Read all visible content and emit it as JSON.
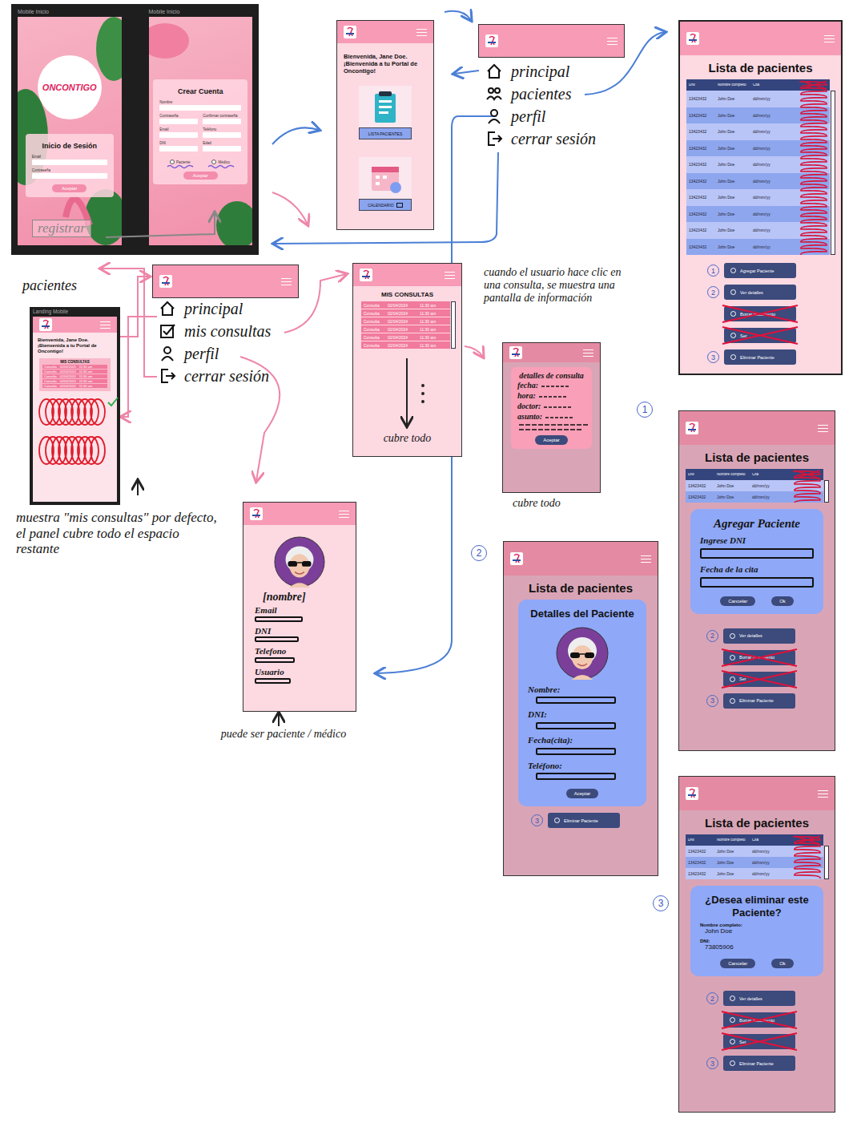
{
  "login": {
    "label": "Mobile Inicio",
    "logo": "ONCONTIGO",
    "title": "Inicio de Sesión",
    "fields": [
      "Email",
      "Contraseña"
    ],
    "button": "Aceptar"
  },
  "register": {
    "label": "Mobile Inicio",
    "title": "Crear Cuenta",
    "fields": [
      [
        "Nombre"
      ],
      [
        "Contraseña",
        "Confirmar contraseña"
      ],
      [
        "Email",
        "Teléfono"
      ],
      [
        "DNI",
        "Edad"
      ]
    ],
    "roles": [
      {
        "label": "Paciente",
        "selected": false
      },
      {
        "label": "Médico",
        "selected": false
      }
    ],
    "button": "Aceptar"
  },
  "landing": {
    "greeting": "Bienvenida, Jane Doe. ¡Bienvenida a tu Portal de Oncontigo!",
    "cards": [
      "LISTA PACIENTES",
      "CALENDARIO"
    ]
  },
  "menu_doctor": {
    "items": [
      "principal",
      "pacientes",
      "perfil",
      "cerrar sesión"
    ]
  },
  "patients": {
    "title": "Lista de pacientes",
    "columns": [
      "DNI",
      "Nombre completo",
      "Cita"
    ],
    "rows": [
      [
        "13423432",
        "John Doe",
        "dd/mm/yy"
      ],
      [
        "13423432",
        "John Doe",
        "dd/mm/yy"
      ],
      [
        "13423432",
        "John Doe",
        "dd/mm/yy"
      ],
      [
        "13423432",
        "John Doe",
        "dd/mm/yy"
      ],
      [
        "13423432",
        "John Doe",
        "dd/mm/yy"
      ],
      [
        "13423432",
        "John Doe",
        "dd/mm/yy"
      ],
      [
        "13423432",
        "John Doe",
        "dd/mm/yy"
      ],
      [
        "13423432",
        "John Doe",
        "dd/mm/yy"
      ],
      [
        "13423432",
        "John Doe",
        "dd/mm/yy"
      ],
      [
        "13423432",
        "John Doe",
        "dd/mm/yy"
      ]
    ],
    "actions": [
      {
        "number": "1",
        "label": "Agregar Paciente",
        "crossed": false
      },
      {
        "number": "2",
        "label": "Ver detalles",
        "crossed": false
      },
      {
        "label": "Borrar documento",
        "crossed": true
      },
      {
        "label": "Ser",
        "crossed": true
      },
      {
        "number": "3",
        "label": "Eliminar Paciente",
        "crossed": false
      }
    ]
  },
  "landing_mobile": {
    "label": "Landing Mobile",
    "greeting": "Bienvenida, Jane Doe. ¡Bienvenida a tu Portal de Oncontigo!",
    "panel_title": "MIS CONSULTAS",
    "rows": [
      [
        "Consulta",
        "02/04/2024",
        "11:30 am"
      ],
      [
        "Consulta",
        "02/04/2024",
        "11:30 am"
      ],
      [
        "Consulta",
        "02/04/2024",
        "11:30 am"
      ],
      [
        "Consulta",
        "02/04/2024",
        "11:30 am"
      ],
      [
        "Consulta",
        "02/04/2024",
        "11:30 am"
      ]
    ]
  },
  "menu_patient": {
    "items": [
      "principal",
      "mis consultas",
      "perfil",
      "cerrar sesión"
    ]
  },
  "consultas": {
    "title": "MIS CONSULTAS",
    "rows": [
      [
        "Consulta",
        "02/04/2024",
        "11:30 am"
      ],
      [
        "Consulta",
        "02/04/2024",
        "11:30 am"
      ],
      [
        "Consulta",
        "02/04/2024",
        "11:30 am"
      ],
      [
        "Consulta",
        "02/04/2024",
        "11:30 am"
      ],
      [
        "Consulta",
        "02/04/2024",
        "11:30 am"
      ],
      [
        "Consulta",
        "02/04/2024",
        "11:30 am"
      ]
    ],
    "note": "cubre todo"
  },
  "consult_detail": {
    "title": "detalles de consulta",
    "fields": [
      "fecha:",
      "hora:",
      "doctor:",
      "asunto:"
    ],
    "button": "Aceptar",
    "note": "cubre todo"
  },
  "profile": {
    "name": "[nombre]",
    "fields": [
      "Email",
      "DNI",
      "Telefono",
      "Usuario"
    ],
    "note": "puede ser paciente / médico"
  },
  "details_screen": {
    "title": "Lista de pacientes",
    "modal_title": "Detalles del Paciente",
    "fields": [
      "Nombre:",
      "DNI:",
      "Fecha(cita):",
      "Teléfono:"
    ],
    "button": "Aceptar",
    "actions": [
      {
        "number": "3",
        "label": "Eliminar Paciente",
        "crossed": false
      }
    ]
  },
  "add_screen": {
    "title": "Lista de pacientes",
    "columns": [
      "DNI",
      "Nombre completo",
      "Cita"
    ],
    "rows": [
      [
        "13423432",
        "John Doe",
        "dd/mm/yy"
      ],
      [
        "13423432",
        "John Doe",
        "dd/mm/yy"
      ]
    ],
    "modal_title": "Agregar Paciente",
    "fields": [
      "Ingrese DNI",
      "Fecha de la cita"
    ],
    "buttons": [
      "Cancelar",
      "Ok"
    ],
    "actions": [
      {
        "number": "2",
        "label": "Ver detalles",
        "crossed": false
      },
      {
        "label": "Borrar documento",
        "crossed": true
      },
      {
        "label": "Ser",
        "crossed": true
      },
      {
        "number": "3",
        "label": "Eliminar Paciente",
        "crossed": false
      }
    ]
  },
  "delete_screen": {
    "title": "Lista de pacientes",
    "columns": [
      "DNI",
      "Nombre completo",
      "Cita"
    ],
    "rows": [
      [
        "13423432",
        "John Doe",
        "dd/mm/yy"
      ],
      [
        "13423432",
        "John Doe",
        "dd/mm/yy"
      ],
      [
        "13423432",
        "John Doe",
        "dd/mm/yy"
      ]
    ],
    "modal_title": "¿Desea eliminar este Paciente?",
    "info": [
      {
        "label": "Nombre completo:",
        "value": "John Doe"
      },
      {
        "label": "DNI:",
        "value": "73805906"
      }
    ],
    "buttons": [
      "Cancelar",
      "Ok"
    ],
    "actions": [
      {
        "number": "2",
        "label": "Ver detalles",
        "crossed": false
      },
      {
        "label": "Borrar documento",
        "crossed": true
      },
      {
        "label": "Ser",
        "crossed": true
      },
      {
        "number": "3",
        "label": "Eliminar Paciente",
        "crossed": false
      }
    ]
  },
  "notes": {
    "registrar": "registrar",
    "pacientes": "pacientes",
    "default_view": "muestra \"mis consultas\" por defecto, el panel cubre todo el espacio restante",
    "consult_click": "cuando el usuario hace clic en una consulta, se muestra una pantalla de información"
  },
  "markers": [
    "1",
    "2",
    "3"
  ]
}
